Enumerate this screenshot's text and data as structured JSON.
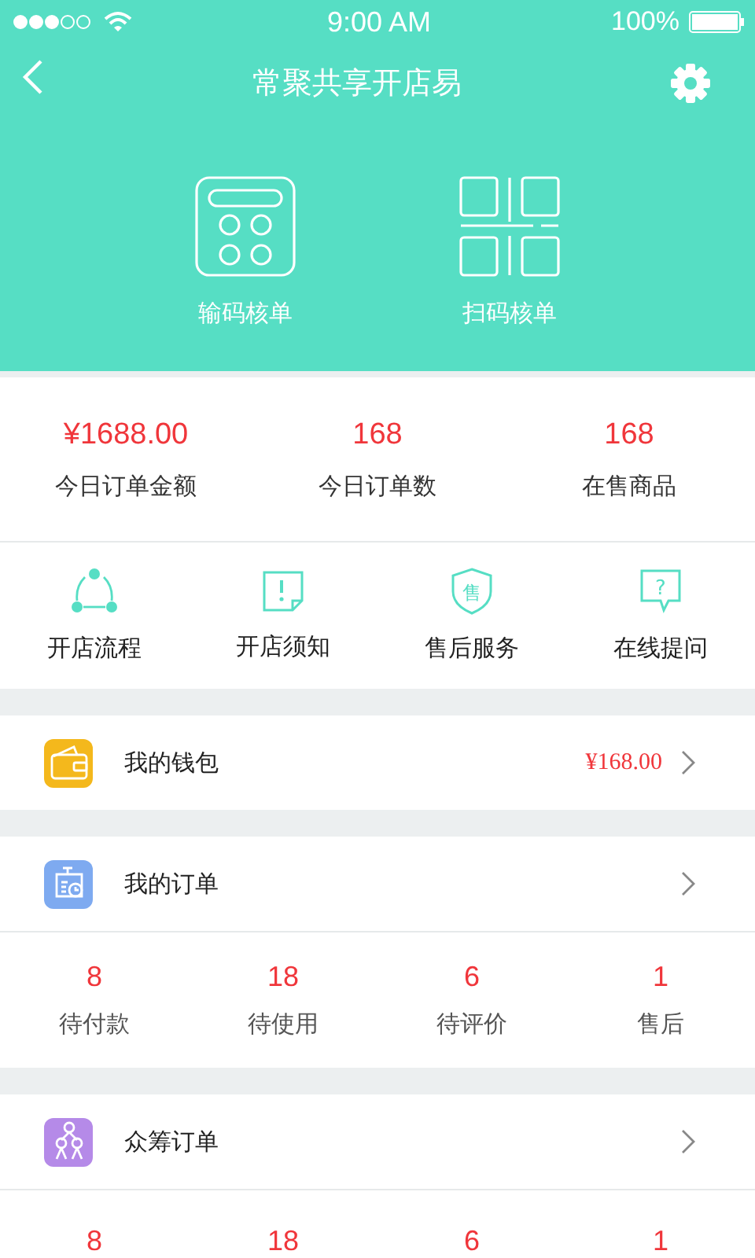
{
  "status_bar": {
    "time": "9:00 AM",
    "battery": "100%"
  },
  "header": {
    "title": "常聚共享开店易"
  },
  "actions": [
    {
      "label": "输码核单"
    },
    {
      "label": "扫码核单"
    }
  ],
  "stats": [
    {
      "value": "¥1688.00",
      "label": "今日订单金额"
    },
    {
      "value": "168",
      "label": "今日订单数"
    },
    {
      "value": "168",
      "label": "在售商品"
    }
  ],
  "shortcuts": [
    {
      "label": "开店流程"
    },
    {
      "label": "开店须知"
    },
    {
      "label": "售后服务",
      "icon_text": "售"
    },
    {
      "label": "在线提问",
      "icon_text": "?"
    }
  ],
  "sections": [
    {
      "title": "我的钱包",
      "color": "#f4b81c",
      "value": "¥168.00"
    },
    {
      "title": "我的订单",
      "color": "#7eaaf0",
      "counts": [
        {
          "value": "8",
          "label": "待付款"
        },
        {
          "value": "18",
          "label": "待使用"
        },
        {
          "value": "6",
          "label": "待评价"
        },
        {
          "value": "1",
          "label": "售后"
        }
      ]
    },
    {
      "title": "众筹订单",
      "color": "#b58ae8",
      "counts": [
        {
          "value": "8"
        },
        {
          "value": "18"
        },
        {
          "value": "6"
        },
        {
          "value": "1"
        }
      ]
    }
  ]
}
